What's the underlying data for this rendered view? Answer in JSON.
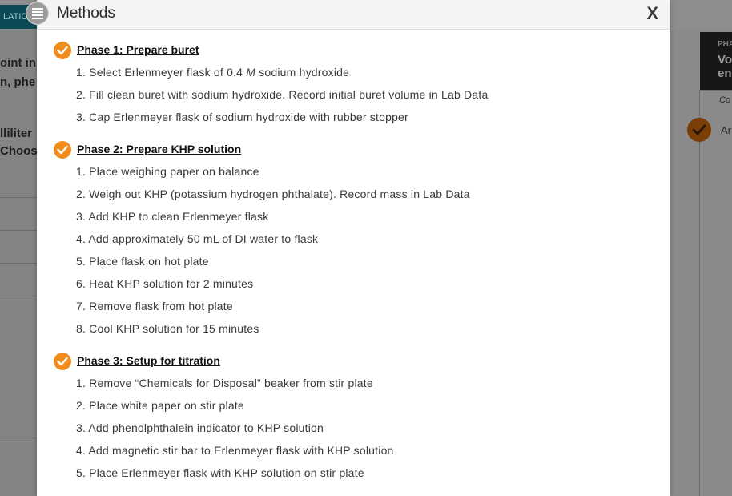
{
  "background": {
    "tab_label": "LATIO",
    "left_lines": [
      "oint in",
      "n, phe",
      "lliliter",
      "Choose"
    ],
    "right_phase": "PHA",
    "right_heading": [
      "Vo",
      "en"
    ],
    "right_col_label": "Co",
    "right_row_text": "Ar"
  },
  "modal": {
    "title": "Methods",
    "close_label": "X",
    "phases": [
      {
        "title": "Phase 1: Prepare buret",
        "steps": [
          "1. Select Erlenmeyer flask of 0.4 M sodium hydroxide",
          "2. Fill clean buret with sodium hydroxide. Record initial buret volume in Lab Data",
          "3. Cap Erlenmeyer flask of sodium hydroxide with rubber stopper"
        ]
      },
      {
        "title": "Phase 2: Prepare KHP solution",
        "steps": [
          "1. Place weighing paper on balance",
          "2. Weigh out KHP (potassium hydrogen phthalate). Record mass in Lab Data",
          "3. Add KHP to clean Erlenmeyer flask",
          "4. Add approximately 50 mL of DI water to flask",
          "5. Place flask on hot plate",
          "6. Heat KHP solution for 2 minutes",
          "7. Remove flask from hot plate",
          "8. Cool KHP solution for 15 minutes"
        ]
      },
      {
        "title": "Phase 3: Setup for titration",
        "steps": [
          "1. Remove “Chemicals for Disposal” beaker from stir plate",
          "2. Place white paper on stir plate",
          "3. Add phenolphthalein indicator to KHP solution",
          "4. Add magnetic stir bar to Erlenmeyer flask with KHP solution",
          "5. Place Erlenmeyer flask with KHP solution on stir plate"
        ]
      }
    ]
  },
  "colors": {
    "check_orange": "#f08c1c",
    "tab_teal": "#0c4a55",
    "overlay_gray": "#7a7a7a"
  },
  "icons": {
    "menu": "list-menu-icon",
    "phase_status": "checkmark-circle-icon",
    "close": "close-icon"
  }
}
